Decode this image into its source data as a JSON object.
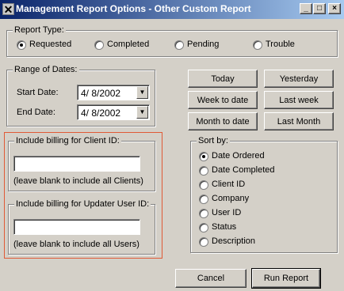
{
  "window": {
    "title": "Management Report Options - Other Custom Report",
    "buttons": {
      "minimize": "_",
      "maximize": "□",
      "close": "×"
    }
  },
  "report_type": {
    "legend": "Report Type:",
    "options": [
      {
        "label": "Requested",
        "checked": true
      },
      {
        "label": "Completed",
        "checked": false
      },
      {
        "label": "Pending",
        "checked": false
      },
      {
        "label": "Trouble",
        "checked": false
      }
    ]
  },
  "date_range": {
    "legend": "Range of Dates:",
    "start_label": "Start Date:",
    "start_value": "4/ 8/2002",
    "end_label": "End Date:",
    "end_value": "4/ 8/2002"
  },
  "quick_dates": {
    "today": "Today",
    "yesterday": "Yesterday",
    "week_to_date": "Week to date",
    "last_week": "Last week",
    "month_to_date": "Month to date",
    "last_month": "Last Month"
  },
  "client_billing": {
    "legend": "Include billing for Client ID:",
    "value": "",
    "hint": "(leave blank to include all Clients)"
  },
  "updater_billing": {
    "legend": "Include billing for Updater User ID:",
    "value": "",
    "hint": "(leave blank to include all Users)"
  },
  "sort_by": {
    "legend": "Sort by:",
    "options": [
      {
        "label": "Date Ordered",
        "checked": true
      },
      {
        "label": "Date Completed",
        "checked": false
      },
      {
        "label": "Client ID",
        "checked": false
      },
      {
        "label": "Company",
        "checked": false
      },
      {
        "label": "User ID",
        "checked": false
      },
      {
        "label": "Status",
        "checked": false
      },
      {
        "label": "Description",
        "checked": false
      }
    ]
  },
  "footer": {
    "cancel": "Cancel",
    "run": "Run Report"
  },
  "colors": {
    "titlebar_start": "#0a246a",
    "titlebar_end": "#a6caf0",
    "dialog_bg": "#d4d0c8",
    "highlight_frame": "#e05a36"
  },
  "icons": {
    "app": "x-app-icon",
    "dropdown": "chevron-down-icon"
  }
}
